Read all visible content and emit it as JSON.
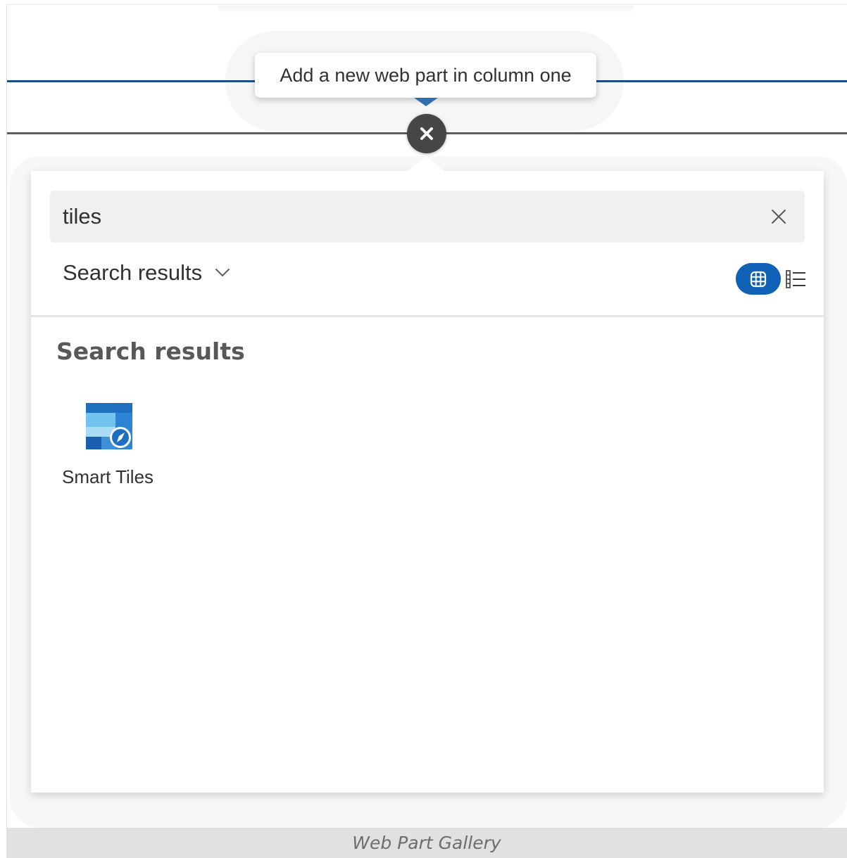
{
  "tooltip": {
    "text": "Add a new web part in column one"
  },
  "icons": {
    "close_circle": "close-icon",
    "search_clear": "dismiss-icon",
    "dropdown": "chevron-down-icon",
    "grid_view": "grid-view-icon",
    "list_view": "list-view-icon",
    "web_part": "smart-tiles-icon"
  },
  "search": {
    "value": "tiles"
  },
  "filter": {
    "label": "Search results"
  },
  "results": {
    "heading": "Search results",
    "items": [
      {
        "label": "Smart Tiles"
      }
    ]
  },
  "caption": {
    "text": "Web Part Gallery"
  },
  "colors": {
    "accent": "#0f62b5",
    "divider_blue": "#1b4e84",
    "close_button": "#484644"
  }
}
